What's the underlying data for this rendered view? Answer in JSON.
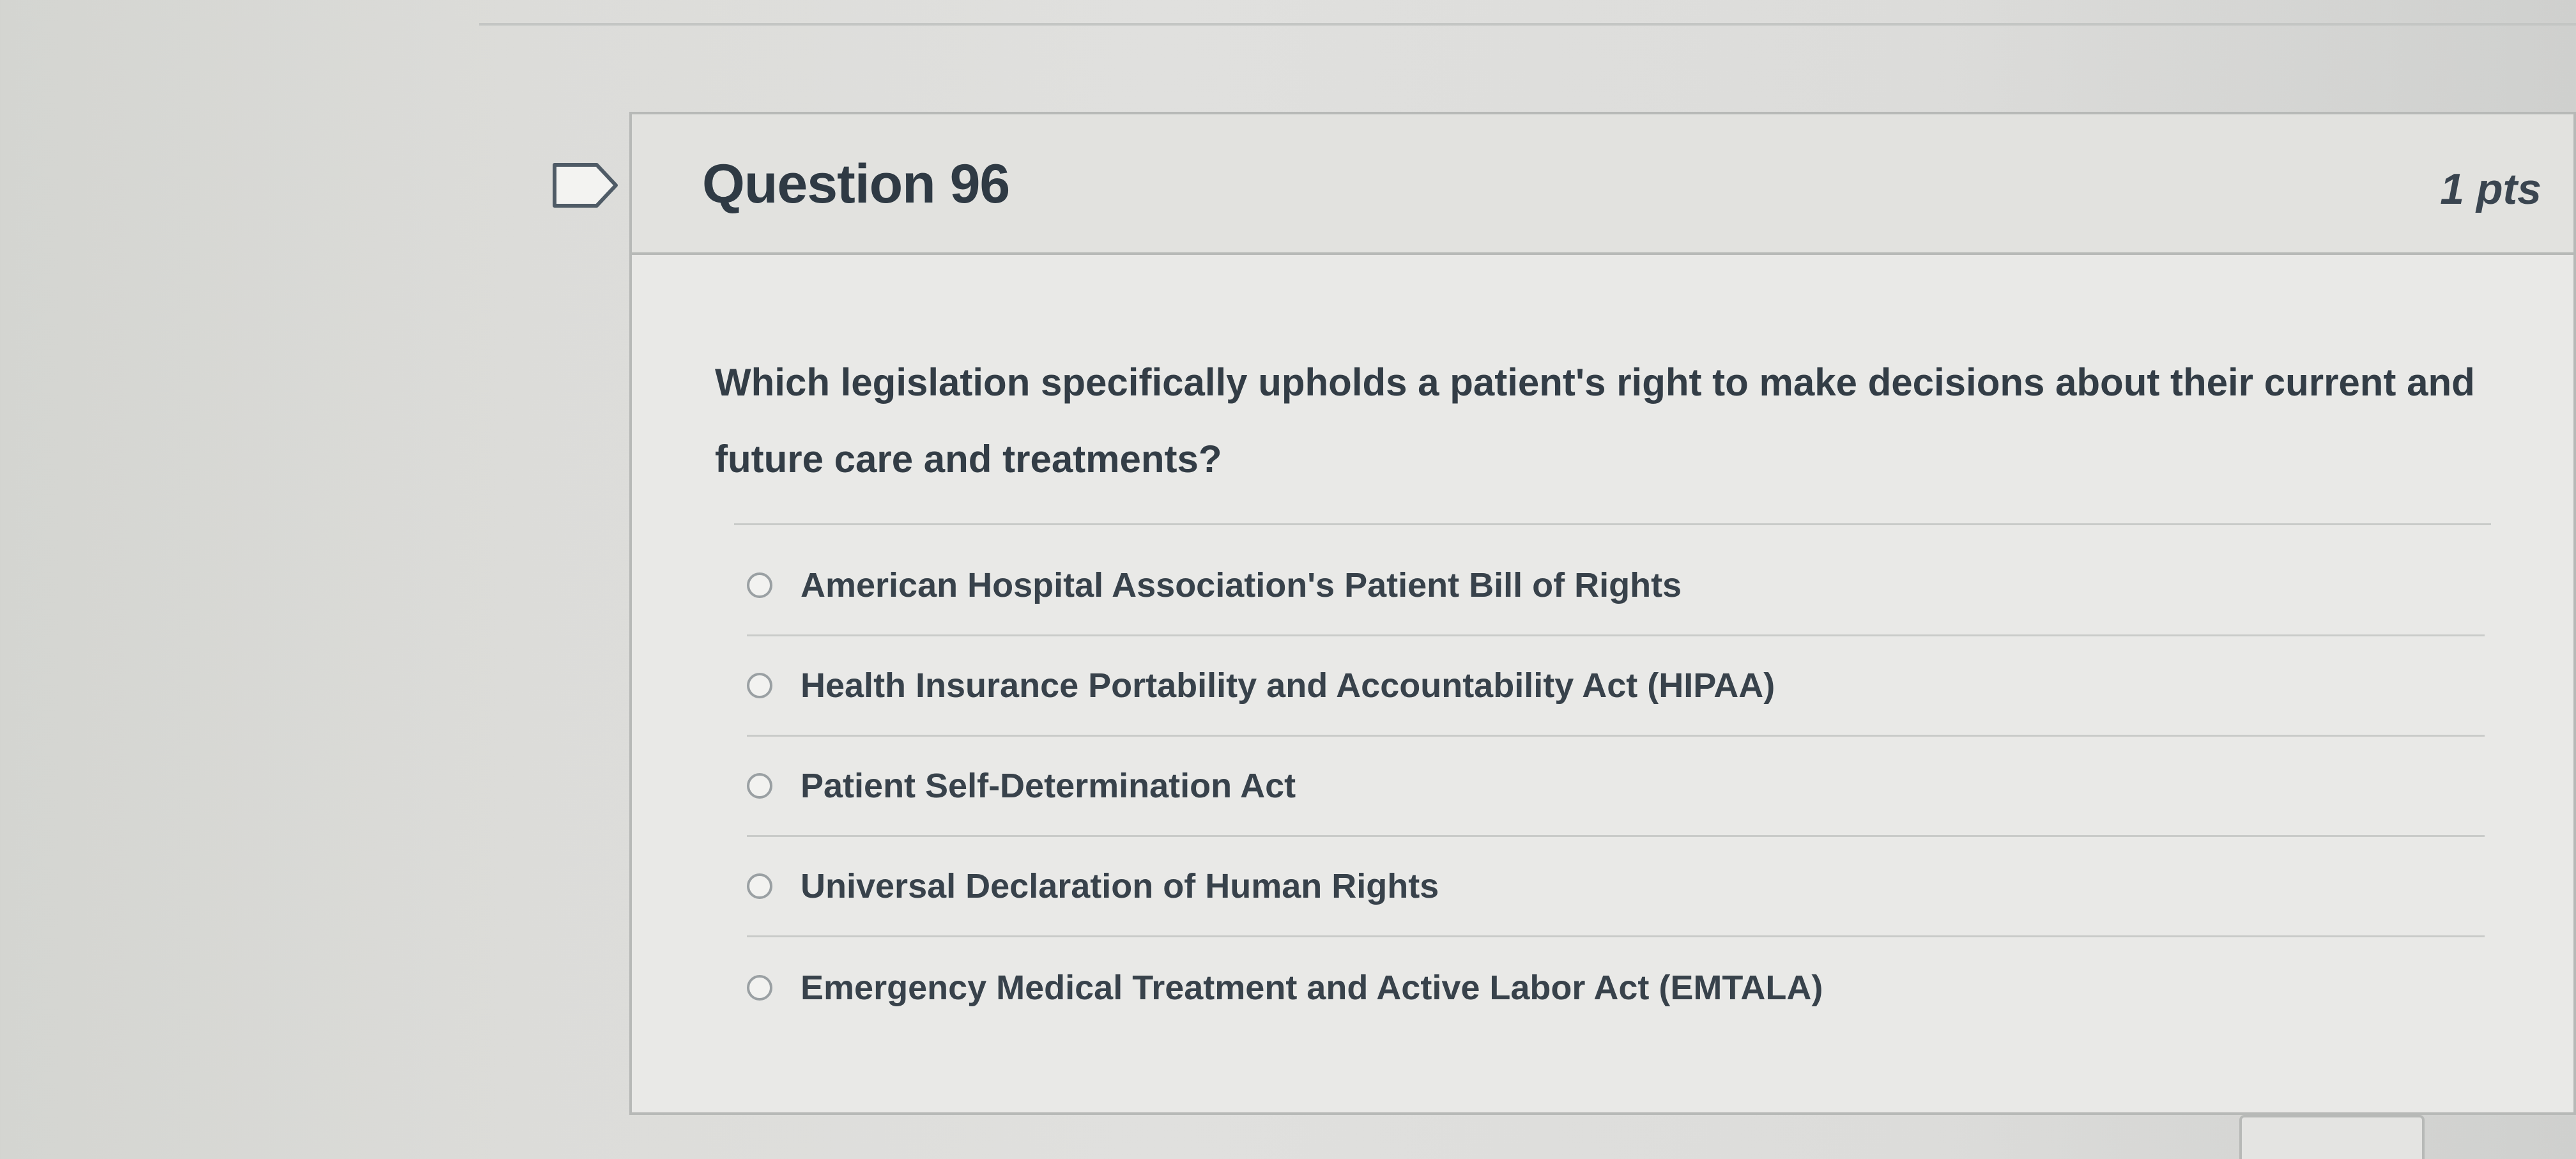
{
  "question": {
    "title": "Question 96",
    "points": "1 pts",
    "text": "Which legislation specifically upholds a patient's right to make decisions about their current and future care and treatments?"
  },
  "answers": [
    {
      "label": "American Hospital Association's Patient Bill of Rights",
      "selected": false
    },
    {
      "label": "Health Insurance Portability and Accountability Act (HIPAA)",
      "selected": false
    },
    {
      "label": "Patient Self-Determination Act",
      "selected": false
    },
    {
      "label": "Universal Declaration of Human Rights",
      "selected": false
    },
    {
      "label": "Emergency Medical Treatment and Active Labor Act (EMTALA)",
      "selected": false
    }
  ],
  "icons": {
    "flag": "flag-question-icon",
    "radio": "radio-button-icon"
  },
  "colors": {
    "card_background": "#e9e9e7",
    "header_background": "#e2e2df",
    "border": "#b7b9b7",
    "text": "#2d3b45"
  }
}
